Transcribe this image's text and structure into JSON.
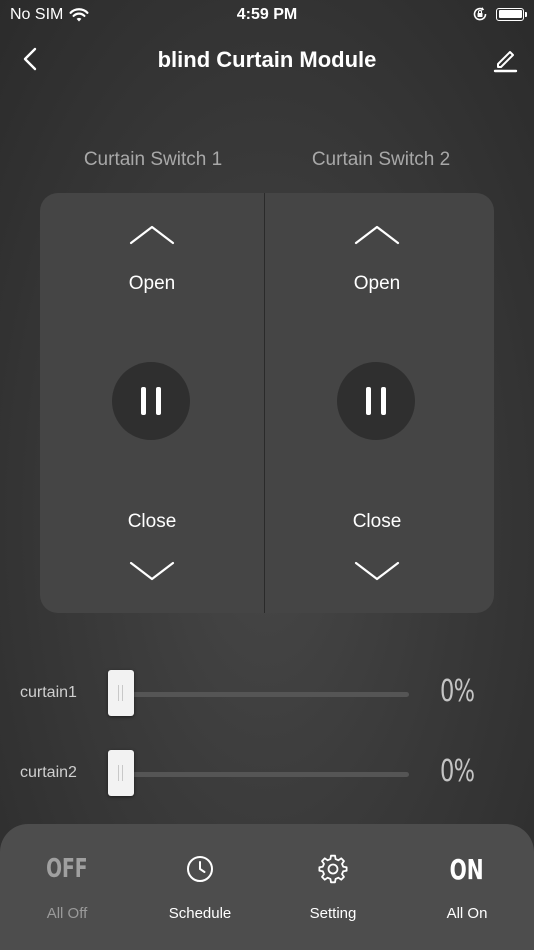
{
  "status_bar": {
    "carrier": "No SIM",
    "time": "4:59 PM",
    "icons": [
      "wifi-icon",
      "orientation-lock-icon",
      "battery-icon"
    ]
  },
  "nav": {
    "title": "blind Curtain Module",
    "back_icon": "chevron-left-icon",
    "edit_icon": "pencil-icon"
  },
  "switches": [
    {
      "label": "Curtain Switch 1",
      "open_label": "Open",
      "close_label": "Close"
    },
    {
      "label": "Curtain Switch 2",
      "open_label": "Open",
      "close_label": "Close"
    }
  ],
  "sliders": [
    {
      "label": "curtain1",
      "value": 0,
      "value_text": "0%"
    },
    {
      "label": "curtain2",
      "value": 0,
      "value_text": "0%"
    }
  ],
  "actions": [
    {
      "label": "All Off",
      "icon_text": "OFF",
      "icon": "off-text-icon"
    },
    {
      "label": "Schedule",
      "icon": "clock-icon"
    },
    {
      "label": "Setting",
      "icon": "gear-icon"
    },
    {
      "label": "All On",
      "icon_text": "ON",
      "icon": "on-text-icon"
    }
  ],
  "colors": {
    "background": "#3a3a3a",
    "panel": "#454545",
    "pause_button": "#2f2f2f",
    "bottom_bar": "#4d4d4d",
    "muted_text": "#a8a8a8"
  }
}
